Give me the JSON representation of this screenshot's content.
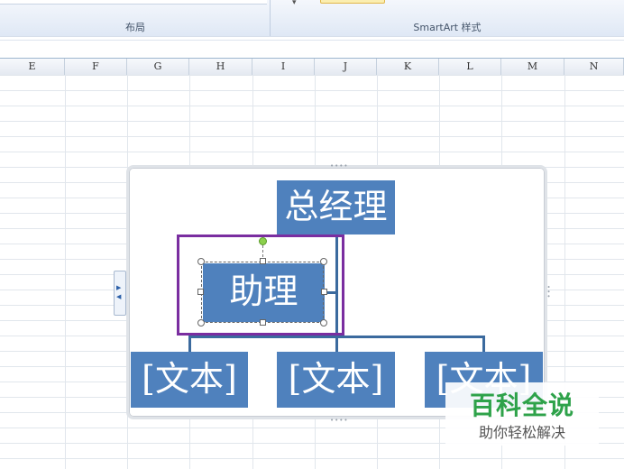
{
  "ribbon": {
    "groups": [
      {
        "label": "布局"
      },
      {
        "label": "SmartArt 样式"
      }
    ]
  },
  "columns": [
    "E",
    "F",
    "G",
    "H",
    "I",
    "J",
    "K",
    "L",
    "M",
    "N"
  ],
  "smartart": {
    "nodes": {
      "general_manager": "总经理",
      "assistant": "助理",
      "text1": "[文本]",
      "text2": "[文本]",
      "text3": "[文本]"
    },
    "node_color": "#4f81bd",
    "highlight_color": "#7a2ea0"
  },
  "watermark": {
    "title": "百科全说",
    "subtitle": "助你轻松解决"
  }
}
